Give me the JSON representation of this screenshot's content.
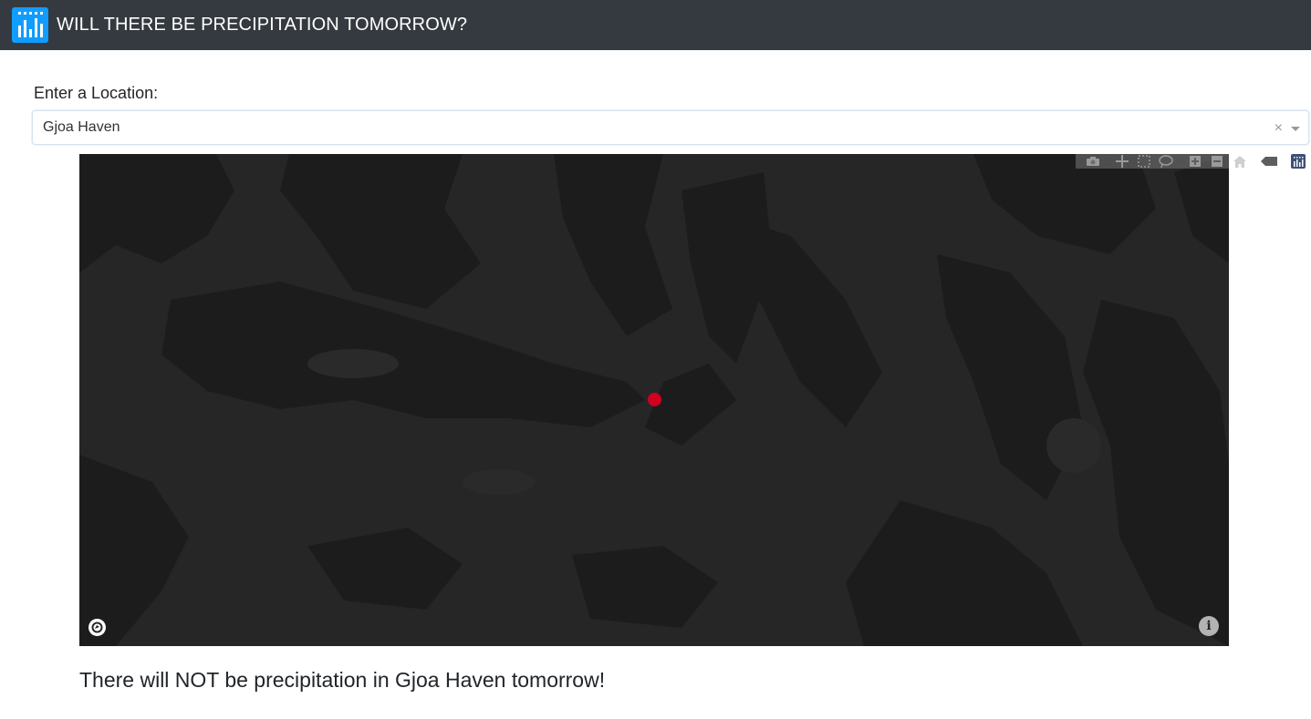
{
  "header": {
    "title": "WILL THERE BE PRECIPITATION TOMORROW?",
    "logo_icon": "dash-bar-chart-logo",
    "bg_color": "#343a40",
    "logo_color": "#119dff"
  },
  "location": {
    "label": "Enter a Location:",
    "selected_value": "Gjoa Haven",
    "clear_symbol": "×"
  },
  "map": {
    "style": "dark",
    "marker_color": "#d1001f",
    "modebar": [
      {
        "name": "camera-icon",
        "label": "Download plot as a png"
      },
      {
        "name": "pan-icon",
        "label": "Pan"
      },
      {
        "name": "box-select-icon",
        "label": "Box Select"
      },
      {
        "name": "lasso-select-icon",
        "label": "Lasso Select"
      },
      {
        "name": "zoom-in-icon",
        "label": "Zoom in"
      },
      {
        "name": "zoom-out-icon",
        "label": "Zoom out"
      },
      {
        "name": "home-icon",
        "label": "Reset view"
      },
      {
        "name": "tag-icon",
        "label": "Toggle Spike Lines"
      },
      {
        "name": "plotly-logo-icon",
        "label": "Produced with Plotly"
      }
    ],
    "info_symbol": "i"
  },
  "result": {
    "text": "There will NOT be precipitation in Gjoa Haven tomorrow!"
  }
}
